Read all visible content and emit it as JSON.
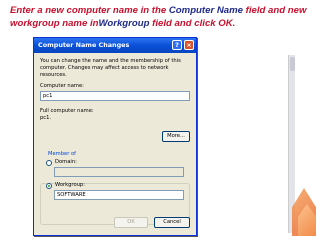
{
  "instruction": {
    "part1": "Enter a new computer name in the ",
    "kw1": "Computer Name",
    "part2": " field and new workgroup name in",
    "kw2": "Workgroup",
    "part3": " field and click OK."
  },
  "dialog": {
    "title": "Computer Name Changes",
    "help_label": "?",
    "close_label": "×",
    "description": "You can change the name and the membership of this computer. Changes may affect access to network resources.",
    "computer_name_label": "Computer name:",
    "computer_name_value": "pc1",
    "full_name_label": "Full computer name:",
    "full_name_value": "pc1.",
    "more_button": "More...",
    "member_of_label": "Member of",
    "domain_label": "Domain:",
    "domain_value": "",
    "workgroup_label": "Workgroup:",
    "workgroup_value": "SOFTWARE",
    "ok_button": "OK",
    "cancel_button": "Cancel"
  },
  "colors": {
    "instruction_text": "#c8102e",
    "instruction_keyword": "#1f2a8a",
    "titlebar": "#0a50d8",
    "dialog_bg": "#ece9d8"
  }
}
